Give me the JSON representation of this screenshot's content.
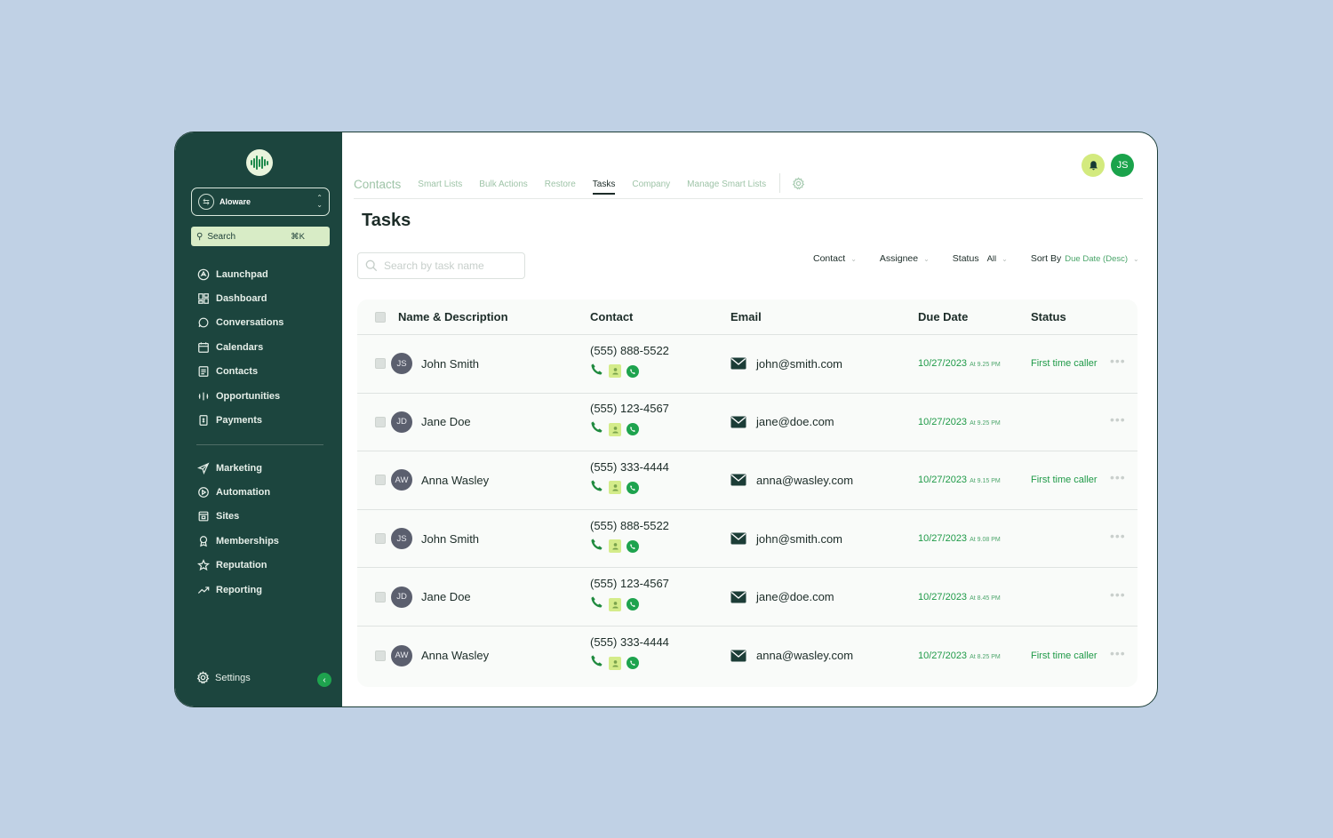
{
  "colors": {
    "sidebar_bg": "#1c453e",
    "accent_green": "#1f9a48",
    "page_bg": "#c0d1e5",
    "search_bg": "#d8ecc6",
    "bell_bg": "#d3ea7e"
  },
  "sidebar": {
    "account": {
      "name": "Aloware"
    },
    "search": {
      "label": "Search",
      "shortcut": "⌘K"
    },
    "nav_primary": [
      {
        "label": "Launchpad",
        "icon": "rocket-icon"
      },
      {
        "label": "Dashboard",
        "icon": "grid-icon"
      },
      {
        "label": "Conversations",
        "icon": "chat-icon"
      },
      {
        "label": "Calendars",
        "icon": "calendar-icon"
      },
      {
        "label": "Contacts",
        "icon": "contacts-icon"
      },
      {
        "label": "Opportunities",
        "icon": "opportunities-icon"
      },
      {
        "label": "Payments",
        "icon": "payments-icon"
      }
    ],
    "nav_secondary": [
      {
        "label": "Marketing",
        "icon": "send-icon"
      },
      {
        "label": "Automation",
        "icon": "automation-icon"
      },
      {
        "label": "Sites",
        "icon": "sites-icon"
      },
      {
        "label": "Memberships",
        "icon": "award-icon"
      },
      {
        "label": "Reputation",
        "icon": "star-icon"
      },
      {
        "label": "Reporting",
        "icon": "trend-icon"
      }
    ],
    "settings_label": "Settings"
  },
  "tabs": [
    {
      "label": "Contacts"
    },
    {
      "label": "Smart Lists"
    },
    {
      "label": "Bulk Actions"
    },
    {
      "label": "Restore"
    },
    {
      "label": "Tasks",
      "active": true
    },
    {
      "label": "Company"
    },
    {
      "label": "Manage Smart Lists"
    }
  ],
  "header": {
    "avatar_initials": "JS"
  },
  "page": {
    "title": "Tasks",
    "search_placeholder": "Search by task name"
  },
  "filters": {
    "contact": "Contact",
    "assignee": "Assignee",
    "status_label": "Status",
    "status_value": "All",
    "sort_label": "Sort By",
    "sort_value": "Due Date (Desc)"
  },
  "table": {
    "headers": {
      "name": "Name & Description",
      "contact": "Contact",
      "email": "Email",
      "due": "Due Date",
      "status": "Status"
    },
    "rows": [
      {
        "initials": "JS",
        "name": "John Smith",
        "phone": "(555) 888-5522",
        "email": "john@smith.com",
        "date": "10/27/2023",
        "time": "At 9.25 PM",
        "status": "First time caller"
      },
      {
        "initials": "JD",
        "name": "Jane Doe",
        "phone": "(555) 123-4567",
        "email": "jane@doe.com",
        "date": "10/27/2023",
        "time": "At 9.25 PM",
        "status": ""
      },
      {
        "initials": "AW",
        "name": "Anna Wasley",
        "phone": "(555) 333-4444",
        "email": "anna@wasley.com",
        "date": "10/27/2023",
        "time": "At 9.15 PM",
        "status": "First time caller"
      },
      {
        "initials": "JS",
        "name": "John Smith",
        "phone": "(555) 888-5522",
        "email": "john@smith.com",
        "date": "10/27/2023",
        "time": "At 9.08 PM",
        "status": ""
      },
      {
        "initials": "JD",
        "name": "Jane Doe",
        "phone": "(555) 123-4567",
        "email": "jane@doe.com",
        "date": "10/27/2023",
        "time": "At 8.45 PM",
        "status": ""
      },
      {
        "initials": "AW",
        "name": "Anna Wasley",
        "phone": "(555) 333-4444",
        "email": "anna@wasley.com",
        "date": "10/27/2023",
        "time": "At 8.25 PM",
        "status": "First time caller"
      }
    ]
  }
}
